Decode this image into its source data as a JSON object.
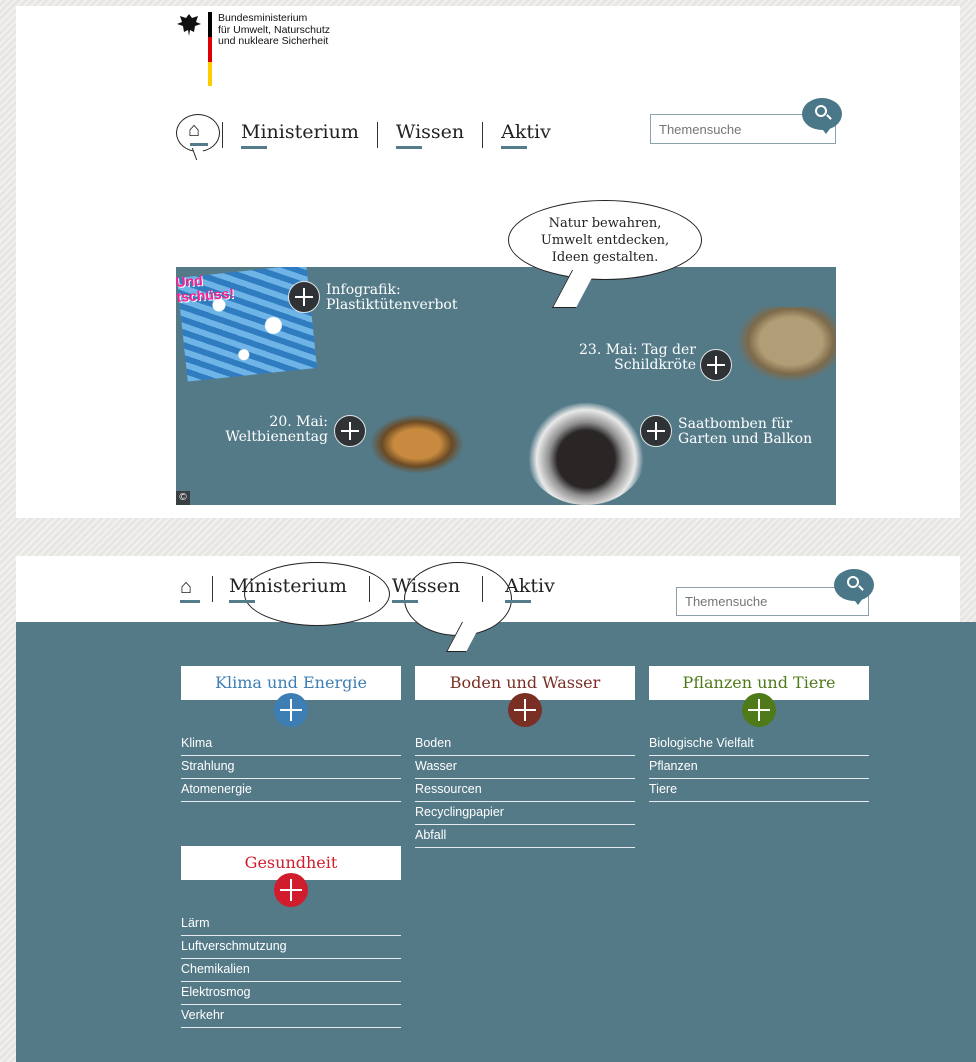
{
  "header": {
    "logo_lines": [
      "Bundesministerium",
      "für Umwelt, Naturschutz",
      "und nukleare Sicherheit"
    ]
  },
  "nav": {
    "items": [
      "Ministerium",
      "Wissen",
      "Aktiv"
    ]
  },
  "search": {
    "placeholder": "Themensuche"
  },
  "speech": {
    "lines": [
      "Natur bewahren,",
      "Umwelt entdecken,",
      "Ideen gestalten."
    ]
  },
  "teaser": {
    "und_label": "Und\ntschüss!",
    "items": [
      {
        "label": "Infografik:\nPlastiktütenverbot"
      },
      {
        "label": "23. Mai: Tag der\nSchildkröte"
      },
      {
        "label": "20. Mai:\nWeltbienentag"
      },
      {
        "label": "Saatbomben für\nGarten und Balkon"
      }
    ],
    "copyright": "©"
  },
  "mega_menu": {
    "categories": [
      {
        "title": "Klima und Energie",
        "color": "#3d7fb5",
        "items": [
          "Klima",
          "Strahlung",
          "Atomenergie"
        ]
      },
      {
        "title": "Boden und Wasser",
        "color": "#7a2f24",
        "items": [
          "Boden",
          "Wasser",
          "Ressourcen",
          "Recyclingpapier",
          "Abfall"
        ]
      },
      {
        "title": "Pflanzen und Tiere",
        "color": "#4e7a1a",
        "items": [
          "Biologische Vielfalt",
          "Pflanzen",
          "Tiere"
        ]
      },
      {
        "title": "Gesundheit",
        "color": "#d01c2c",
        "items": [
          "Lärm",
          "Luftverschmutzung",
          "Chemikalien",
          "Elektrosmog",
          "Verkehr"
        ]
      }
    ]
  }
}
